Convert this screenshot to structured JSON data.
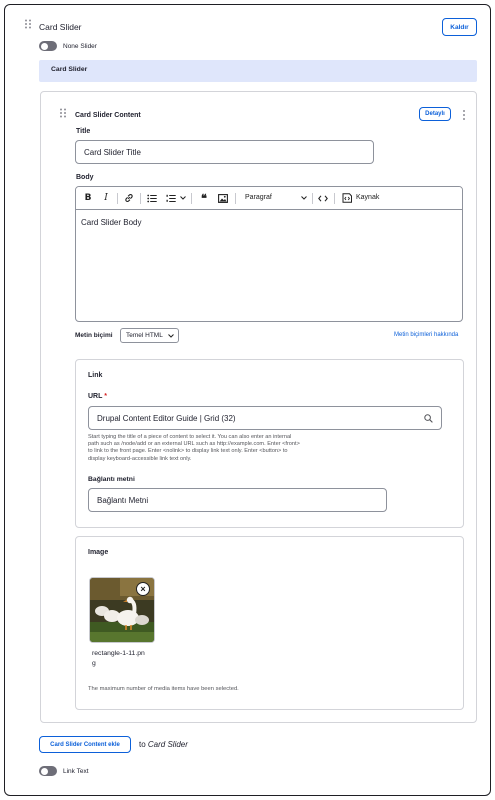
{
  "section": {
    "title": "Card Slider",
    "remove_label": "Kaldır",
    "toggle_label": "None Slider",
    "banner_label": "Card Slider"
  },
  "content_card": {
    "title": "Card Slider Content",
    "edit_label": "Detaylı",
    "title_field": {
      "label": "Title",
      "value": "Card Slider Title"
    },
    "body_field": {
      "label": "Body",
      "toolbar": {
        "paragraph_label": "Paragraf",
        "source_label": "Kaynak"
      },
      "value": "Card Slider Body"
    },
    "text_format": {
      "label": "Metin biçimi",
      "selected": "Temel HTML",
      "help_link": "Metin biçimleri hakkında"
    },
    "link": {
      "heading": "Link",
      "url_label": "URL",
      "required_mark": "*",
      "url_value": "Drupal Content Editor Guide | Grid (32)",
      "help_lines": [
        "Start typing the title of a piece of content to select it. You can also enter an internal",
        "path such as /node/add or an external URL such as http://example.com. Enter <front>",
        "to link to the front page. Enter <nolink> to display link text only. Enter <button> to",
        "display keyboard-accessible link text only."
      ],
      "link_text_label": "Bağlantı metni",
      "link_text_value": "Bağlantı Metni"
    },
    "image": {
      "heading": "Image",
      "filename_line1": "rectangle-1-11.pn",
      "filename_line2": "g",
      "remove_symbol": "×",
      "note": "The maximum number of media items have been selected."
    }
  },
  "footer": {
    "add_button": "Card Slider Content ekle",
    "to_text": "to",
    "to_target": "Card Slider",
    "toggle_label": "Link Text"
  },
  "colors": {
    "accent": "#0c60d9",
    "banner_bg": "#dfe6fb",
    "border": "#d3d4d9"
  },
  "icons": [
    "drag-handle-icon",
    "bold-icon",
    "italic-icon",
    "link-icon",
    "bulleted-list-icon",
    "numbered-list-icon",
    "blockquote-icon",
    "image-icon",
    "code-icon",
    "source-icon",
    "search-icon",
    "kebab-menu-icon",
    "close-icon"
  ]
}
